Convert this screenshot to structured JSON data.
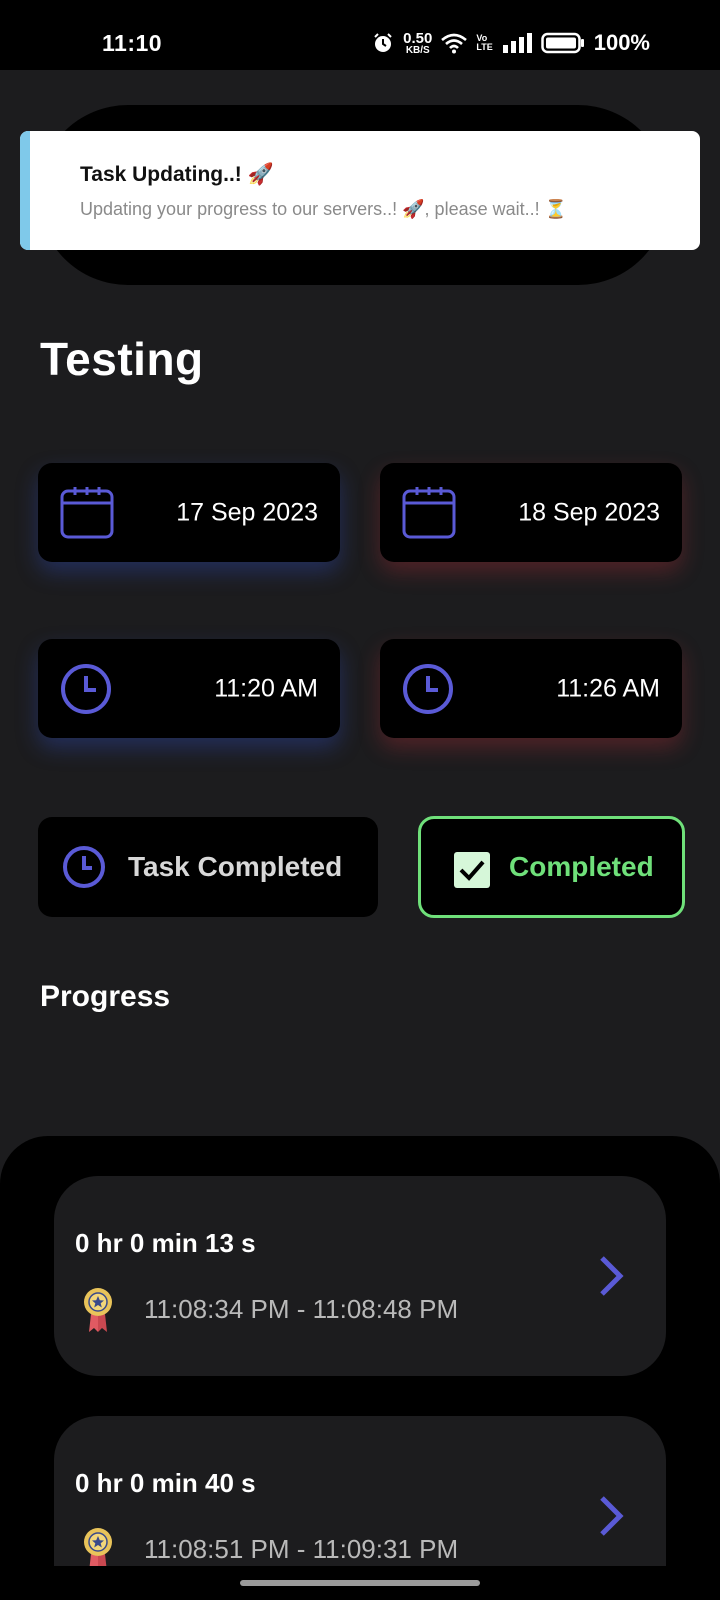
{
  "status_bar": {
    "time": "11:10",
    "net_speed_value": "0.50",
    "net_speed_unit": "KB/S",
    "volte_top": "Vo",
    "volte_bottom": "LTE",
    "battery": "100%"
  },
  "toast": {
    "title": "Task Updating..! 🚀",
    "body": "Updating your progress to our servers..! 🚀, please wait..! ⏳"
  },
  "task": {
    "title": "Testing",
    "start_date": "17 Sep 2023",
    "end_date": "18 Sep 2023",
    "start_time": "11:20 AM",
    "end_time": "11:26 AM",
    "status_label": "Task Completed",
    "completed_label": "Completed"
  },
  "progress": {
    "section_title": "Progress",
    "items": [
      {
        "duration": "0 hr 0 min 13 s",
        "range": "11:08:34 PM - 11:08:48 PM"
      },
      {
        "duration": "0 hr 0 min 40 s",
        "range": "11:08:51 PM - 11:09:31 PM"
      }
    ]
  },
  "colors": {
    "accent": "#5a5ad6",
    "completed": "#6fe07a",
    "toast_accent": "#7fc9ea"
  }
}
